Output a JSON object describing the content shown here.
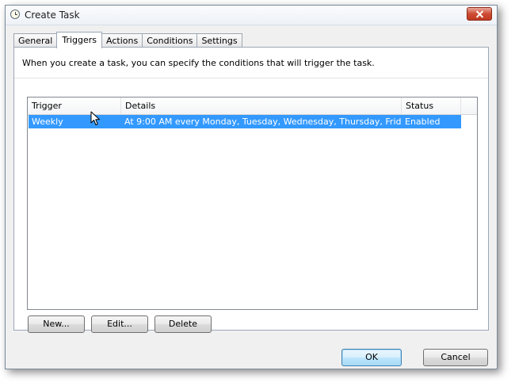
{
  "window": {
    "title": "Create Task"
  },
  "tabs": [
    {
      "label": "General",
      "active": false
    },
    {
      "label": "Triggers",
      "active": true
    },
    {
      "label": "Actions",
      "active": false
    },
    {
      "label": "Conditions",
      "active": false
    },
    {
      "label": "Settings",
      "active": false
    }
  ],
  "triggers_tab": {
    "description": "When you create a task, you can specify the conditions that will trigger the task.",
    "columns": {
      "trigger": "Trigger",
      "details": "Details",
      "status": "Status"
    },
    "rows": [
      {
        "trigger": "Weekly",
        "details": "At 9:00 AM every Monday, Tuesday, Wednesday, Thursday, Frid...",
        "status": "Enabled",
        "selected": true
      }
    ],
    "buttons": {
      "new": "New...",
      "edit": "Edit...",
      "delete": "Delete"
    }
  },
  "dialog_buttons": {
    "ok": "OK",
    "cancel": "Cancel"
  },
  "colors": {
    "selection": "#3399ff",
    "close_button": "#c03a22"
  }
}
